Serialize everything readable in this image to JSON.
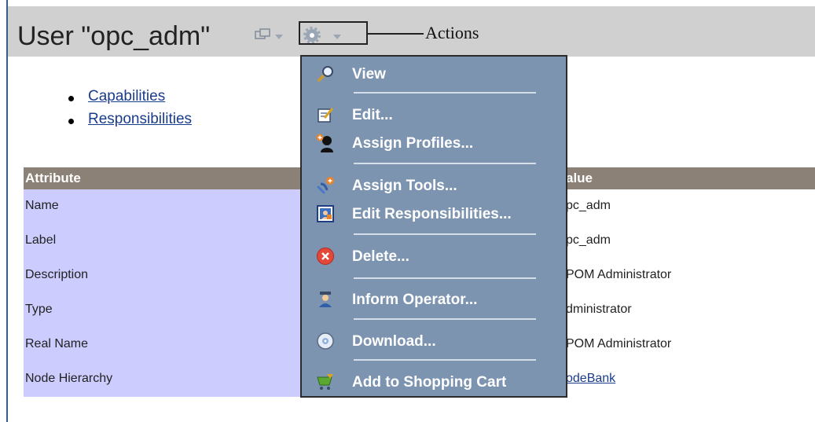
{
  "header": {
    "title": "User \"opc_adm\""
  },
  "callout": {
    "label": "Actions"
  },
  "links": [
    {
      "label": "Capabilities"
    },
    {
      "label": "Responsibilities"
    }
  ],
  "table": {
    "columns": [
      "Attribute",
      "alue"
    ],
    "rows": [
      {
        "attribute": "Name",
        "value": "pc_adm"
      },
      {
        "attribute": "Label",
        "value": "pc_adm"
      },
      {
        "attribute": "Description",
        "value": "POM Administrator"
      },
      {
        "attribute": "Type",
        "value": "dministrator"
      },
      {
        "attribute": "Real Name",
        "value": "POM Administrator"
      },
      {
        "attribute": "Node Hierarchy",
        "value": "odeBank"
      }
    ]
  },
  "menu": {
    "items": [
      {
        "label": "View",
        "icon": "magnifier-icon"
      },
      {
        "label": "Edit...",
        "icon": "edit-icon"
      },
      {
        "label": "Assign Profiles...",
        "icon": "profile-icon"
      },
      {
        "label": "Assign Tools...",
        "icon": "tools-icon"
      },
      {
        "label": "Edit Responsibilities...",
        "icon": "responsibilities-icon"
      },
      {
        "label": "Delete...",
        "icon": "delete-icon"
      },
      {
        "label": "Inform Operator...",
        "icon": "operator-icon"
      },
      {
        "label": "Download...",
        "icon": "download-icon"
      },
      {
        "label": "Add to Shopping Cart",
        "icon": "cart-icon"
      }
    ]
  },
  "colors": {
    "header_bg": "#d0d0d0",
    "menu_bg": "#7c94b0",
    "table_header_bg": "#8c8176",
    "attribute_bg": "#ccccff",
    "link": "#1a3c8c"
  }
}
